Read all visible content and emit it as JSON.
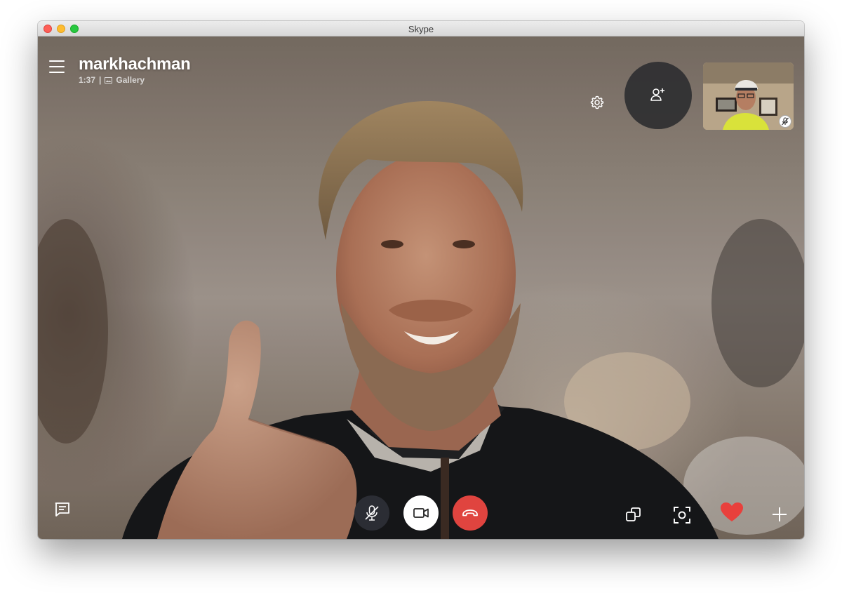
{
  "window": {
    "title": "Skype",
    "controls": [
      "close",
      "minimize",
      "maximize"
    ]
  },
  "call": {
    "caller_name": "markhachman",
    "duration": "1:37",
    "separator": "|",
    "view_mode": "Gallery",
    "view_mode_icon": "gallery-icon"
  },
  "top_controls": {
    "settings_icon": "gear-icon",
    "add_participant_icon": "add-person-icon",
    "self_view": {
      "label": "self video preview",
      "muted": true,
      "mute_icon": "mic-off-icon"
    }
  },
  "bottom_controls": {
    "chat_icon": "chat-icon",
    "mic": {
      "icon": "mic-off-icon",
      "state": "muted"
    },
    "video": {
      "icon": "video-camera-icon",
      "state": "on"
    },
    "end_call": {
      "icon": "hang-up-icon"
    },
    "switch_camera_icon": "switch-camera-icon",
    "snapshot_icon": "snapshot-icon",
    "reaction_icon": "heart-icon",
    "more_icon": "plus-icon"
  },
  "colors": {
    "end_call": "#e0443f",
    "heart": "#e8403c",
    "button_dark": "#2d3037",
    "titlebar": "#e3e3e3"
  }
}
